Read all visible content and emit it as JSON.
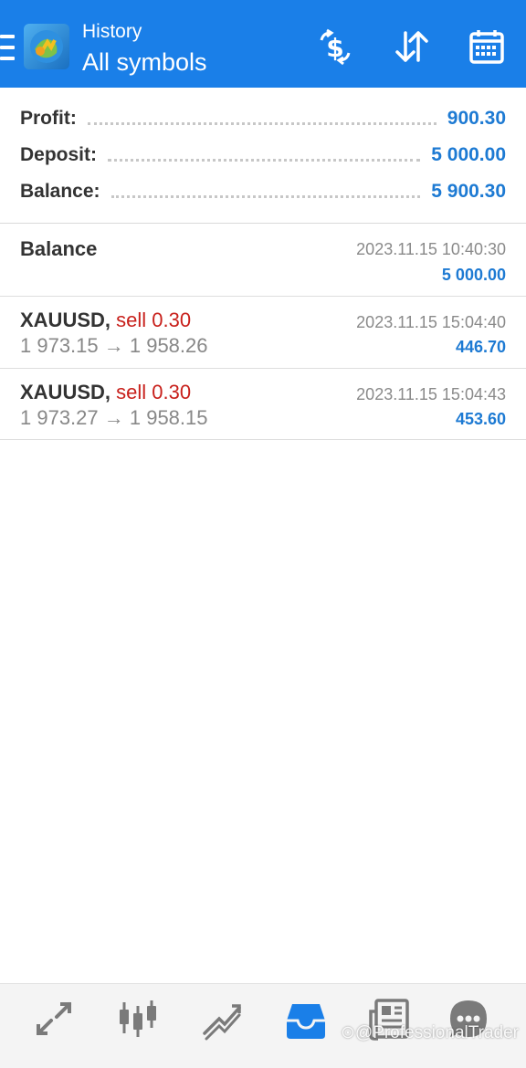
{
  "header": {
    "subtitle": "History",
    "title": "All symbols",
    "icons": [
      "menu-icon",
      "app-logo",
      "dollar-exchange-icon",
      "sort-icon",
      "calendar-icon"
    ]
  },
  "summary": {
    "profit_label": "Profit:",
    "profit_value": "900.30",
    "deposit_label": "Deposit:",
    "deposit_value": "5 000.00",
    "balance_label": "Balance:",
    "balance_value": "5 900.30"
  },
  "deals": [
    {
      "title": "Balance",
      "time": "2023.11.15 10:40:30",
      "amount": "5 000.00"
    },
    {
      "symbol": "XAUUSD,",
      "type": "sell 0.30",
      "prices": "1 973.15 → 1 958.26",
      "time": "2023.11.15 15:04:40",
      "amount": "446.70"
    },
    {
      "symbol": "XAUUSD,",
      "type": "sell 0.30",
      "prices": "1 973.27 → 1 958.15",
      "time": "2023.11.15 15:04:43",
      "amount": "453.60"
    }
  ],
  "bottom_nav": {
    "items": [
      "quotes-icon",
      "chart-icon",
      "trade-icon",
      "history-icon",
      "news-icon",
      "messages-icon"
    ],
    "active": "history-icon"
  },
  "watermark": "⊙@ProfessionalTrader",
  "colors": {
    "header_bg": "#1a7fe8",
    "value_blue": "#1d7ad3",
    "sell_red": "#c8201b",
    "active_nav": "#1a7fe8"
  }
}
